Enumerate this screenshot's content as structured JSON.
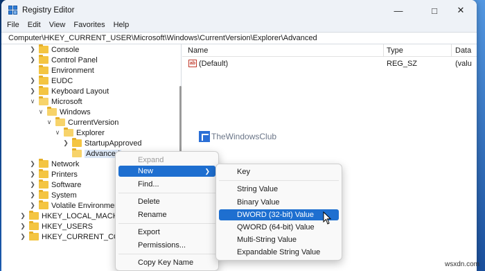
{
  "window": {
    "title": "Registry Editor"
  },
  "menubar": [
    "File",
    "Edit",
    "View",
    "Favorites",
    "Help"
  ],
  "address": "Computer\\HKEY_CURRENT_USER\\Microsoft\\Windows\\CurrentVersion\\Explorer\\Advanced",
  "tree": [
    {
      "label": "Console"
    },
    {
      "label": "Control Panel"
    },
    {
      "label": "Environment"
    },
    {
      "label": "EUDC"
    },
    {
      "label": "Keyboard Layout"
    },
    {
      "label": "Microsoft"
    },
    {
      "label": "Windows"
    },
    {
      "label": "CurrentVersion"
    },
    {
      "label": "Explorer"
    },
    {
      "label": "StartupApproved"
    },
    {
      "label": "Advanced"
    },
    {
      "label": "Network"
    },
    {
      "label": "Printers"
    },
    {
      "label": "Software"
    },
    {
      "label": "System"
    },
    {
      "label": "Volatile Environment"
    },
    {
      "label": "HKEY_LOCAL_MACHINE"
    },
    {
      "label": "HKEY_USERS"
    },
    {
      "label": "HKEY_CURRENT_CONFIG"
    }
  ],
  "list": {
    "columns": {
      "name": "Name",
      "type": "Type",
      "data": "Data"
    },
    "rows": [
      {
        "name": "(Default)",
        "type": "REG_SZ",
        "data": "(valu"
      }
    ]
  },
  "context_menu": {
    "expand": "Expand",
    "new": "New",
    "find": "Find...",
    "delete": "Delete",
    "rename": "Rename",
    "export": "Export",
    "permissions": "Permissions...",
    "copy_key_name": "Copy Key Name"
  },
  "submenu": {
    "key": "Key",
    "string_value": "String Value",
    "binary_value": "Binary Value",
    "dword_value": "DWORD (32-bit) Value",
    "qword_value": "QWORD (64-bit) Value",
    "multi_string_value": "Multi-String Value",
    "expandable_string_value": "Expandable String Value"
  },
  "watermark": "TheWindowsClub",
  "credit": "wsxdn.com",
  "colors": {
    "highlight": "#1e6fd0",
    "folder": "#f4c542"
  }
}
